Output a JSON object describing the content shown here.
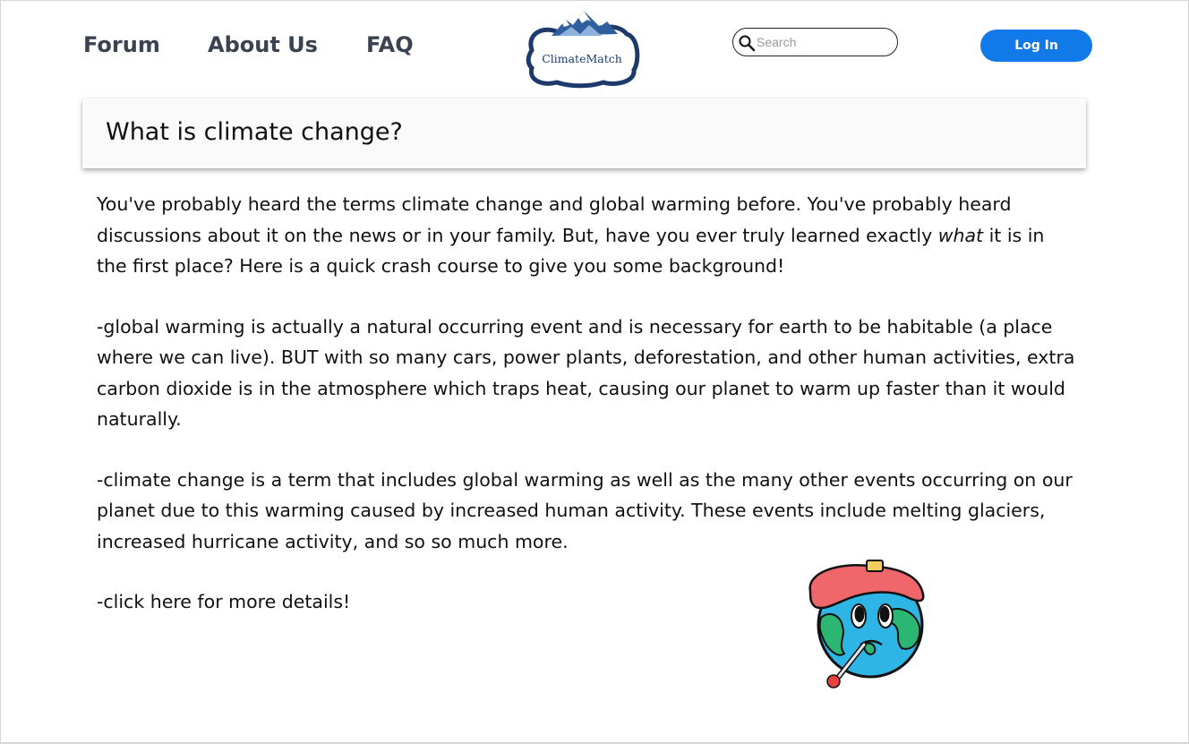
{
  "nav": {
    "forum": "Forum",
    "about": "About Us",
    "faq": "FAQ"
  },
  "logo": {
    "text": "ClimateMatch"
  },
  "search": {
    "placeholder": "Search",
    "value": ""
  },
  "login": {
    "label": "Log In"
  },
  "colors": {
    "accent": "#1279e8",
    "nav_text": "#3b4350",
    "logo_blue": "#1e3c6b"
  },
  "article": {
    "title": "What is climate change?",
    "p1_before": "You've probably heard the terms climate change and global warming before. You've probably heard discussions about it on the news or in your family. But, have you ever truly learned exactly ",
    "p1_em": "what",
    "p1_after": " it is in the first place? Here is a quick crash course to give you some background!",
    "p2": "-global warming is actually a natural occurring event and is necessary for earth to be habitable (a place where we can live). BUT with so many cars, power plants, deforestation, and other human activities, extra carbon dioxide is in the atmosphere which traps heat, causing our planet to warm up faster than it would naturally.",
    "p3": "-climate change is a term that includes global warming as well as the many other events occurring on our planet due to this warming caused by increased human activity. These events include melting glaciers, increased hurricane activity, and so so much more.",
    "p4": "-click here for more details!"
  },
  "illustration": {
    "icon": "sick-earth-icon"
  }
}
